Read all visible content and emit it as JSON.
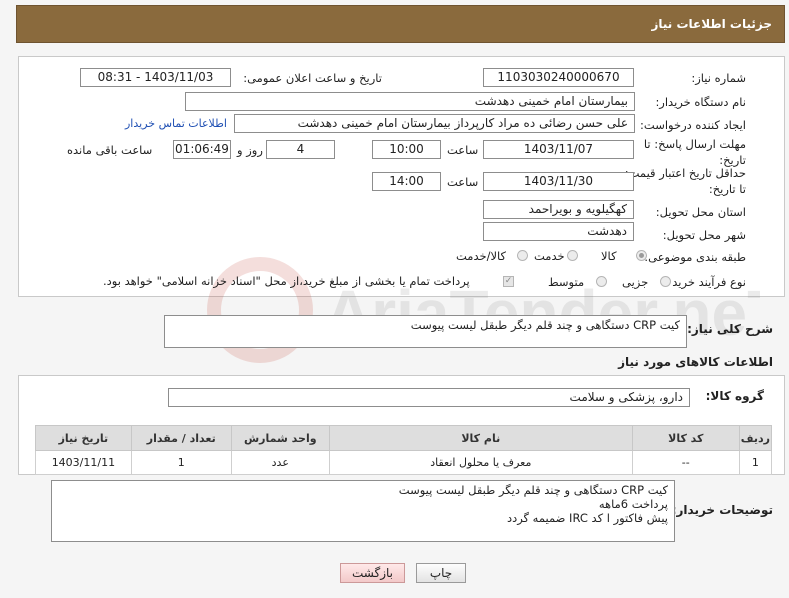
{
  "header": {
    "title": "جزئیات اطلاعات نیاز"
  },
  "form": {
    "need_number": {
      "label": "شماره نیاز:",
      "value": "1103030240000670"
    },
    "announce": {
      "label": "تاریخ و ساعت اعلان عمومی:",
      "value": "1403/11/03 - 08:31"
    },
    "buyer_org": {
      "label": "نام دستگاه خریدار:",
      "value": "بیمارستان امام خمینی دهدشت"
    },
    "creator": {
      "label": "ایجاد کننده درخواست:",
      "value": "علی حسن رضائی ده مراد کارپرداز بیمارستان امام خمینی دهدشت",
      "contact_link": "اطلاعات تماس خریدار"
    },
    "deadline": {
      "label": "مهلت ارسال پاسخ: تا تاریخ:",
      "date": "1403/11/07",
      "time_label": "ساعت",
      "time": "10:00",
      "days": "4",
      "days_label": "روز و",
      "remaining": "01:06:49",
      "remaining_label": "ساعت باقی مانده"
    },
    "price_validity": {
      "label": "حداقل تاریخ اعتبار قیمت: تا تاریخ:",
      "date": "1403/11/30",
      "time_label": "ساعت",
      "time": "14:00"
    },
    "province": {
      "label": "استان محل تحویل:",
      "value": "کهگیلویه و بویراحمد"
    },
    "city": {
      "label": "شهر محل تحویل:",
      "value": "دهدشت"
    },
    "category": {
      "label": "طبقه بندی موضوعی:",
      "options": [
        "کالا",
        "خدمت",
        "کالا/خدمت"
      ]
    },
    "process": {
      "label": "نوع فرآیند خرید :",
      "options": [
        "جزیی",
        "متوسط"
      ],
      "note": "پرداخت تمام یا بخشی از مبلغ خرید،از محل \"اسناد خزانه اسلامی\" خواهد بود."
    }
  },
  "description": {
    "label": "شرح کلی نیاز:",
    "value": "کیت CRP دستگاهی و چند قلم دیگر طبقل لیست پیوست"
  },
  "goods": {
    "section_title": "اطلاعات کالاهای مورد نیاز",
    "group_label": "گروه کالا:",
    "group_value": "دارو، پزشکی و سلامت",
    "columns": [
      "ردیف",
      "کد کالا",
      "نام کالا",
      "واحد شمارش",
      "تعداد / مقدار",
      "تاریخ نیاز"
    ],
    "rows": [
      [
        "1",
        "--",
        "معرف یا محلول انعقاد",
        "عدد",
        "1",
        "1403/11/11"
      ]
    ]
  },
  "buyer_notes": {
    "label": "توضیحات خریدار:",
    "value": "کیت CRP دستگاهی و چند قلم دیگر طبقل لیست پیوست\nپرداخت 6ماهه\nپیش فاکتور ا کد IRC ضمیمه گردد"
  },
  "buttons": {
    "print": "چاپ",
    "back": "بازگشت"
  },
  "watermark": {
    "text": "AriaTender.neT"
  }
}
